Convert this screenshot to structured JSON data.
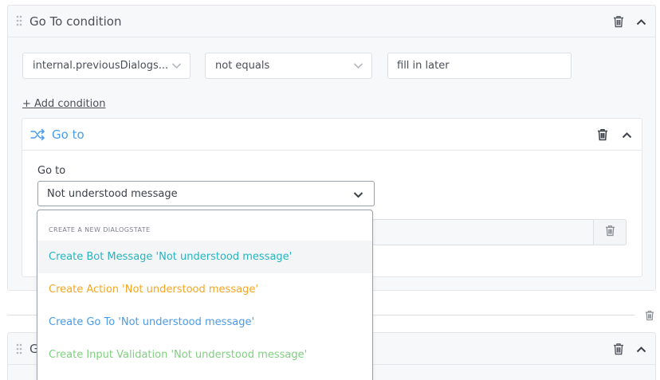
{
  "condition_block": {
    "title": "Go To condition",
    "field_select": "internal.previousDialogs...",
    "operator_select": "not equals",
    "value_input": "fill in later",
    "add_condition_label": "+ Add condition"
  },
  "goto_block": {
    "title": "Go to",
    "field_label": "Go to",
    "selected_value": "Not understood message",
    "accent_color": "#4a9be8"
  },
  "dropdown": {
    "header": "CREATE A NEW DIALOGSTATE",
    "items": [
      {
        "label": "Create Bot Message 'Not understood message'",
        "color": "#26b5c0"
      },
      {
        "label": "Create Action 'Not understood message'",
        "color": "#f5a623"
      },
      {
        "label": "Create Go To 'Not understood message'",
        "color": "#4a9be8"
      },
      {
        "label": "Create Input Validation 'Not understood message'",
        "color": "#7ed07e"
      }
    ]
  },
  "next_block": {
    "title_partial": "G"
  },
  "icons": {
    "drag": "drag-handle-icon",
    "trash": "trash-icon",
    "collapse": "chevron-up-icon",
    "expand": "chevron-down-icon",
    "goto": "shuffle-arrows-icon"
  }
}
